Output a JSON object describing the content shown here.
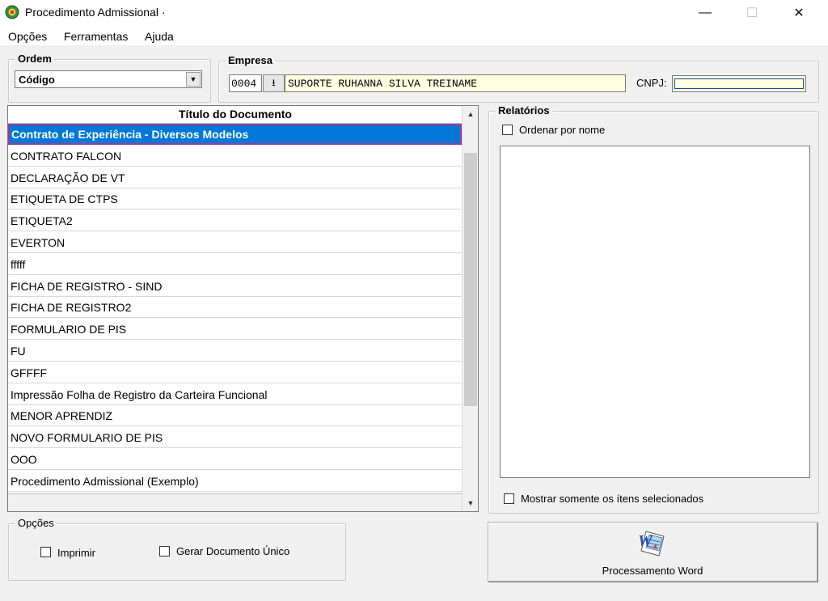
{
  "window": {
    "title": "Procedimento Admissional ·",
    "minimize": "—",
    "maximize": "☐",
    "close": "✕"
  },
  "menu": [
    "Opções",
    "Ferramentas",
    "Ajuda"
  ],
  "ordem": {
    "legend": "Ordem",
    "value": "Código"
  },
  "empresa": {
    "legend": "Empresa",
    "code": "0004",
    "name": "SUPORTE RUHANNA SILVA TREINAME",
    "cnpj_label": "CNPJ:"
  },
  "documents": {
    "header": "Título do Documento",
    "rows": [
      "Contrato de Experiência - Diversos Modelos",
      "CONTRATO FALCON",
      "DECLARAÇÃO DE VT",
      "ETIQUETA DE CTPS",
      "ETIQUETA2",
      "EVERTON",
      "fffff",
      "FICHA DE REGISTRO - SIND",
      "FICHA DE REGISTRO2",
      "FORMULARIO DE PIS",
      "FU",
      "GFFFF",
      "Impressão Folha de Registro da Carteira Funcional",
      "MENOR APRENDIZ",
      "NOVO FORMULARIO DE PIS",
      "OOO",
      "Procedimento Admissional (Exemplo)"
    ],
    "selected_index": 0
  },
  "relatorios": {
    "legend": "Relatórios",
    "sort_by_name": "Ordenar por nome",
    "show_selected_only": "Mostrar somente os ítens selecionados"
  },
  "opcoes": {
    "legend": "Opções",
    "print": "Imprimir",
    "single_doc": "Gerar Documento Único"
  },
  "word_button": {
    "label": "Processamento Word"
  }
}
